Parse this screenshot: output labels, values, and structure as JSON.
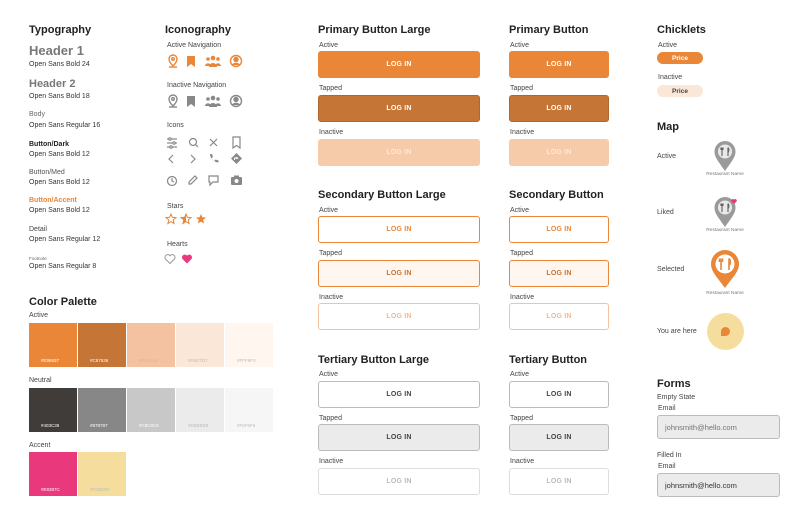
{
  "typography": {
    "title": "Typography",
    "items": [
      {
        "name": "Header 1",
        "spec": "Open Sans  Bold  24"
      },
      {
        "name": "Header 2",
        "spec": "Open Sans  Bold  18"
      },
      {
        "name": "Body",
        "spec": "Open Sans  Regular 16"
      },
      {
        "name": "Button/Dark",
        "spec": "Open Sans  Bold 12"
      },
      {
        "name": "Button/Med",
        "spec": "Open Sans  Bold 12"
      },
      {
        "name": "Button/Accent",
        "spec": "Open Sans  Bold 12"
      },
      {
        "name": "Detail",
        "spec": "Open Sans  Regular 12"
      },
      {
        "name": "Footnote",
        "spec": "Open Sans  Regular 8"
      }
    ]
  },
  "iconography": {
    "title": "Iconography",
    "active_nav": "Active Navigation",
    "inactive_nav": "Inactive Navigation",
    "icons": "Icons",
    "stars": "Stars",
    "hearts": "Hearts"
  },
  "palette": {
    "title": "Color Palette",
    "active_label": "Active",
    "neutral_label": "Neutral",
    "accent_label": "Accent",
    "active": [
      "#E98637",
      "#C57536",
      "#F4C2A0",
      "#FBE7D7",
      "#FFF6F0"
    ],
    "neutral": [
      "#403C39",
      "#878787",
      "#C8C8C8",
      "#EBEBEB",
      "#F6F6F6"
    ],
    "accent": [
      "#E9387C",
      "#F5DE9D"
    ]
  },
  "primary_large": {
    "title": "Primary Button Large",
    "active": "Active",
    "tapped": "Tapped",
    "inactive": "Inactive",
    "label": "LOG IN"
  },
  "primary": {
    "title": "Primary Button",
    "active": "Active",
    "tapped": "Tapped",
    "inactive": "Inactive",
    "label": "LOG IN"
  },
  "secondary_large": {
    "title": "Secondary Button Large",
    "active": "Active",
    "tapped": "Tapped",
    "inactive": "Inactive",
    "label": "LOG IN"
  },
  "secondary": {
    "title": "Secondary Button",
    "active": "Active",
    "tapped": "Tapped",
    "inactive": "Inactive",
    "label": "LOG IN"
  },
  "tertiary_large": {
    "title": "Tertiary Button Large",
    "active": "Active",
    "tapped": "Tapped",
    "inactive": "Inactive",
    "label": "LOG IN"
  },
  "tertiary": {
    "title": "Tertiary Button",
    "active": "Active",
    "tapped": "Tapped",
    "inactive": "Inactive",
    "label": "LOG IN"
  },
  "chicklets": {
    "title": "Chicklets",
    "active": "Active",
    "inactive": "Inactive",
    "label": "Price"
  },
  "map": {
    "title": "Map",
    "active": "Active",
    "liked": "Liked",
    "selected": "Selected",
    "you_are_here": "You are here",
    "restaurant_name": "Restaurant Name"
  },
  "forms": {
    "title": "Forms",
    "empty_state": "Empty State",
    "email_label": "Email",
    "empty_placeholder": "johnsmith@hello.com",
    "filled_in": "Filled In",
    "filled_value": "johnsmith@hello.com"
  }
}
